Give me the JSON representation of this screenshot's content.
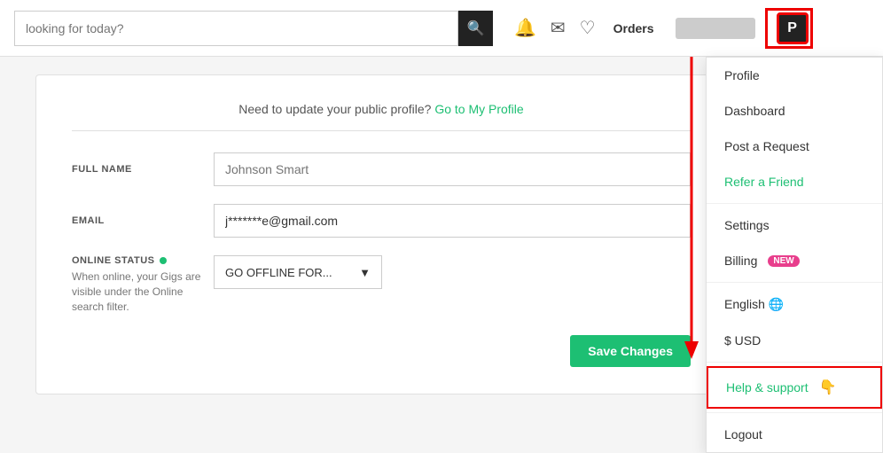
{
  "header": {
    "search_placeholder": "looking for today?",
    "search_icon": "🔍",
    "bell_icon": "🔔",
    "mail_icon": "✉",
    "heart_icon": "♡",
    "orders_label": "Orders",
    "user_initial": "P"
  },
  "profile_notice": {
    "text": "Need to update your public profile?",
    "link_text": "Go to My Profile"
  },
  "form": {
    "full_name_label": "FULL NAME",
    "full_name_placeholder": "Johnson Smart",
    "email_label": "EMAIL",
    "email_value": "j*******e@gmail.com",
    "online_status_label": "ONLINE STATUS",
    "online_status_description": "When online, your Gigs are visible under the Online search filter.",
    "status_dropdown_value": "GO OFFLINE FOR...",
    "save_button_label": "Save Changes"
  },
  "dropdown_menu": {
    "items": [
      {
        "label": "Profile",
        "class": ""
      },
      {
        "label": "Dashboard",
        "class": ""
      },
      {
        "label": "Post a Request",
        "class": ""
      },
      {
        "label": "Refer a Friend",
        "class": "green"
      },
      {
        "label": "Settings",
        "class": ""
      },
      {
        "label": "Billing",
        "badge": "NEW",
        "class": ""
      },
      {
        "label": "English 🌐",
        "class": ""
      },
      {
        "label": "$ USD",
        "class": ""
      },
      {
        "label": "Help & support",
        "class": "help"
      },
      {
        "label": "Logout",
        "class": ""
      }
    ]
  }
}
